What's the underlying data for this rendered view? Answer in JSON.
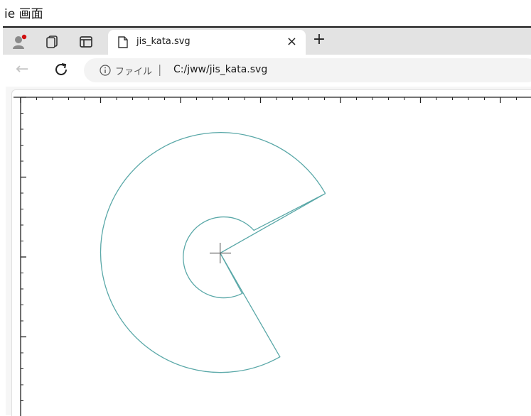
{
  "caption": "ie 画面",
  "browser": {
    "tab": {
      "title": "jis_kata.svg",
      "close_icon": "×",
      "new_tab_icon": "+"
    },
    "address": {
      "file_label": "ファイル",
      "separator": "|",
      "url": "C:/jww/jis_kata.svg"
    },
    "icons": [
      "profile-icon",
      "collections-icon",
      "tab-actions-icon",
      "file-icon",
      "back-icon",
      "reload-icon",
      "info-icon"
    ]
  },
  "drawing": {
    "stroke_color": "#5aa8a8",
    "ruler_color": "#222222",
    "crosshair_color": "#666666"
  }
}
